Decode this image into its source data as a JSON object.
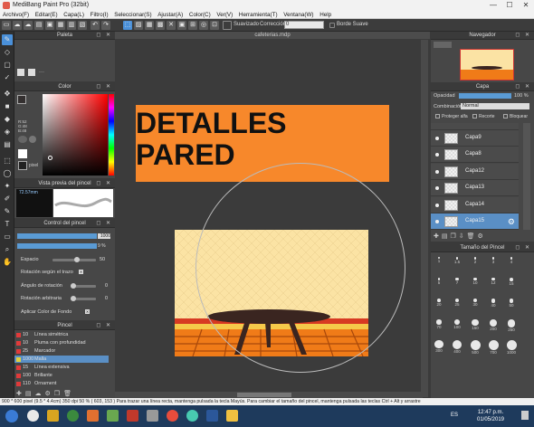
{
  "window": {
    "title": "MediBang Paint Pro (32bit)",
    "minimize": "—",
    "maximize": "☐",
    "close": "✕"
  },
  "menu": [
    "Archivo(F)",
    "Editar(E)",
    "Capa(L)",
    "Filtro(I)",
    "Seleccionar(S)",
    "Ajustar(A)",
    "Color(C)",
    "Ver(V)",
    "Herramienta(T)",
    "Ventana(W)",
    "Help"
  ],
  "toolbar": {
    "suavizado_label": "Suavizado",
    "correccion_label": "Corrección",
    "correccion_value": "0",
    "borde_suave_label": "Borde Suave"
  },
  "document": {
    "tab_title": "cafeterias.mdp",
    "canvas_text_line1": "DETALLES",
    "canvas_text_line2": "PARED",
    "text_bg_color": "#f7882b"
  },
  "panels": {
    "paleta_title": "Paleta",
    "color_title": "Color",
    "color_values": {
      "r": "R:52",
      "g": "G:48",
      "b": "B:48"
    },
    "pixel_label": "pixel",
    "brush_preview_title": "Vista previa del pincel",
    "brush_preview_size": "72.57mm",
    "control_title": "Control del pincel",
    "control": {
      "size_value": "1000",
      "opacity_value": "9 %",
      "espacio_label": "Espacio",
      "espacio_value": "50",
      "rotacion_trazo_label": "Rotación según el trazo",
      "angulo_label": "Ángulo de rotación",
      "angulo_value": "0",
      "rotacion_arbitraria_label": "Rotación arbitraria",
      "rotacion_arbitraria_value": "0",
      "aplicar_color_label": "Aplicar Color de Fondo"
    },
    "pincel_title": "Pincel",
    "brushes": [
      {
        "size": "10",
        "name": "Línea simétrica",
        "color": "#e03a3a"
      },
      {
        "size": "10",
        "name": "Pluma con profundidad",
        "color": "#e03a3a"
      },
      {
        "size": "25",
        "name": "Marcador",
        "color": "#e03a3a"
      },
      {
        "size": "1000",
        "name": "Malla",
        "color": "#e0d040"
      },
      {
        "size": "15",
        "name": "Línea extensiva",
        "color": "#e03a3a"
      },
      {
        "size": "100",
        "name": "Brillante",
        "color": "#e03a3a"
      },
      {
        "size": "110",
        "name": "Ornament",
        "color": "#e03a3a"
      }
    ],
    "navegador_title": "Navegador",
    "capa_title": "Capa",
    "opacidad_label": "Opacidad",
    "opacidad_value": "100 %",
    "combinacion_label": "Combinación",
    "combinacion_value": "Normal",
    "proteger_alfa_label": "Proteger alfa",
    "recorte_label": "Recorte",
    "bloquear_label": "Bloquear",
    "layers": [
      "Capa9",
      "Capa8",
      "Capa12",
      "Capa13",
      "Capa14",
      "Capa15"
    ],
    "selected_layer": "Capa15",
    "tamano_title": "Tamaño del Pincel",
    "brush_sizes": [
      "1",
      "1.5",
      "2",
      "3",
      "4",
      "5",
      "7",
      "10",
      "12",
      "15",
      "20",
      "25",
      "30",
      "40",
      "50",
      "70",
      "100",
      "150",
      "200",
      "250",
      "300",
      "400",
      "500",
      "700",
      "1000"
    ]
  },
  "status": {
    "text": "900 * 600 pixel  (9.5 * 4.4cm)  350 dpi  50 %  ( 603, 153 )  Para trazar una línea recta, mantenga pulsada la tecla Mayús. Para cambiar el tamaño del pincel, mantenga pulsada las teclas Ctrl + Alt y arrastre"
  },
  "taskbar": {
    "language": "ES",
    "time": "12:47 p.m.",
    "date": "01/05/2019"
  }
}
